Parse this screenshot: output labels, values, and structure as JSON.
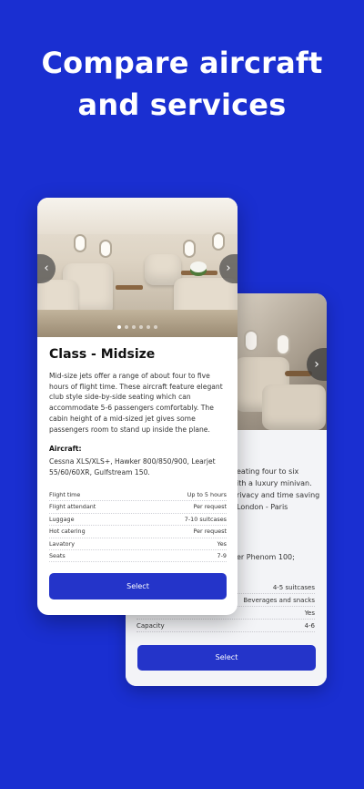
{
  "headline": {
    "line1": "Compare aircraft",
    "line2": "and services"
  },
  "front_card": {
    "class_title": "Class - Midsize",
    "description": "Mid-size jets offer a range of about four to five hours of flight time. These aircraft feature elegant club style side-by-side seating which can accommodate 5-6 passengers comfortably. The cabin height of a mid-sized jet gives some passengers room to stand up inside the plane.",
    "aircraft_label": "Aircraft:",
    "aircraft_list": "Cessna XLS/XLS+, Hawker 800/850/900, Learjet 55/60/60XR, Gulfstream 150.",
    "specs": [
      {
        "label": "Flight time",
        "value": "Up to 5 hours"
      },
      {
        "label": "Flight attendant",
        "value": "Per request"
      },
      {
        "label": "Luggage",
        "value": "7-10 suitcases"
      },
      {
        "label": "Hot catering",
        "value": "Per request"
      },
      {
        "label": "Lavatory",
        "value": "Yes"
      },
      {
        "label": "Seats",
        "value": "7-9"
      }
    ],
    "select_label": "Select",
    "prev_icon": "chevron-left-icon",
    "next_icon": "chevron-right-icon",
    "photo_dots": 6,
    "active_dot": 0
  },
  "back_card": {
    "desc_line1": "eating four to six",
    "desc_line2": "ith a luxury minivan.",
    "desc_line3": "rivacy and time saving",
    "desc_line4": "London - Paris",
    "aircraft_partial": "er Phenom 100;",
    "specs": [
      {
        "label": "",
        "value": "4-5 suitcases"
      },
      {
        "label": "",
        "value": "Beverages and snacks"
      },
      {
        "label": "",
        "value": "Yes"
      },
      {
        "label": "Capacity",
        "value": "4-6"
      }
    ],
    "select_label": "Select",
    "next_icon": "chevron-right-icon"
  },
  "colors": {
    "background": "#1a2fd1",
    "button": "#2434c9",
    "card": "#ffffff"
  }
}
